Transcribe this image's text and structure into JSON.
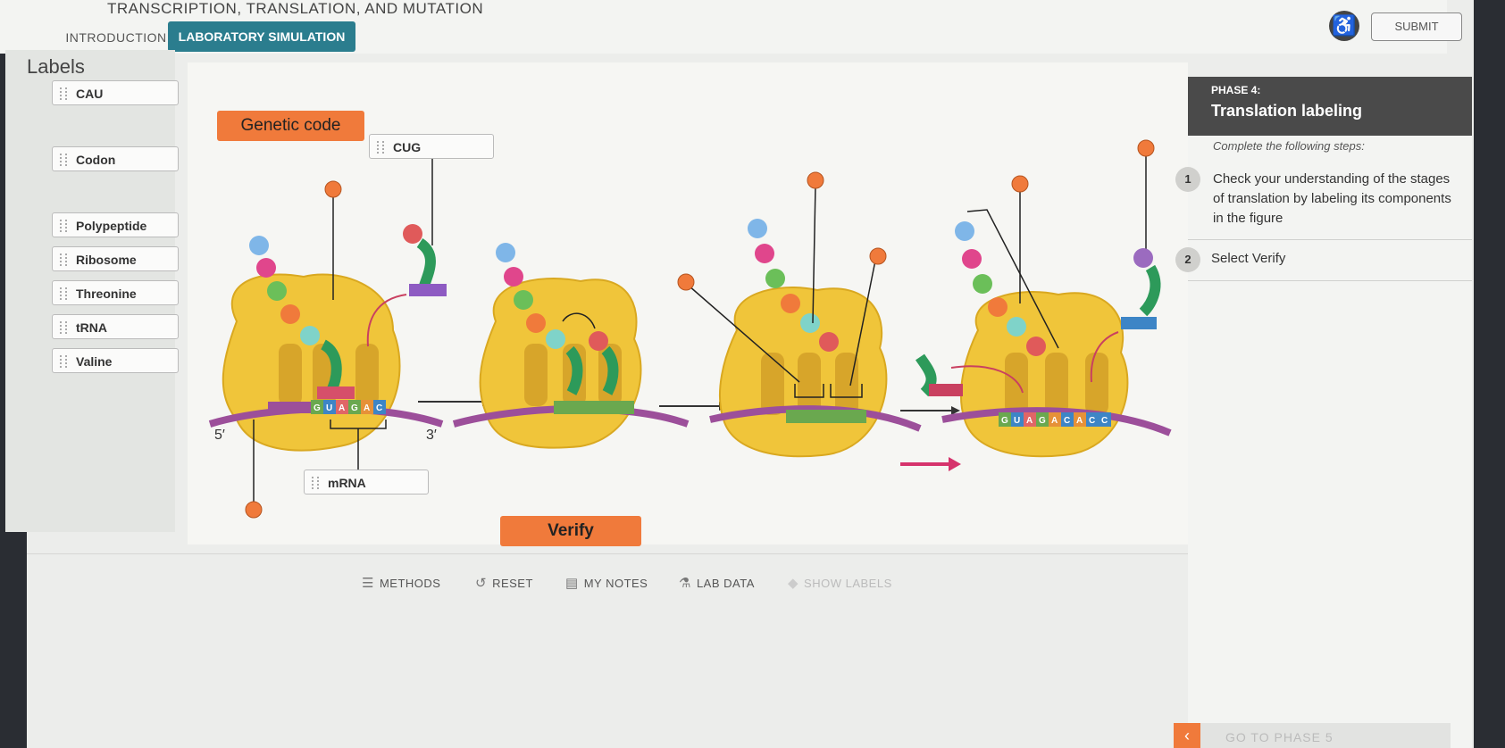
{
  "header": {
    "title_fragment": "TRANSCRIPTION, TRANSLATION, AND MUTATION",
    "tabs": [
      "INTRODUCTION",
      "LABORATORY SIMULATION"
    ],
    "submit_label": "SUBMIT",
    "accessibility_icon": "accessibility-icon"
  },
  "labels_panel": {
    "title": "Labels",
    "chips": [
      "CAU",
      "Codon",
      "Polypeptide",
      "Ribosome",
      "Threonine",
      "tRNA",
      "Valine"
    ]
  },
  "figure": {
    "genetic_code_label": "Genetic code",
    "placed_labels": [
      "CUG",
      "mRNA"
    ],
    "five_prime": "5′",
    "three_prime": "3′",
    "verify_label": "Verify",
    "codons": {
      "panel1": [
        "G",
        "U",
        "A",
        "G",
        "A",
        "C"
      ],
      "panel4": [
        "G",
        "U",
        "A",
        "G",
        "A",
        "C",
        "A",
        "C",
        "C"
      ]
    }
  },
  "toolbar": {
    "items": [
      {
        "label": "METHODS",
        "icon": "methods-icon"
      },
      {
        "label": "RESET",
        "icon": "reset-icon"
      },
      {
        "label": "MY NOTES",
        "icon": "notes-icon"
      },
      {
        "label": "LAB DATA",
        "icon": "flask-icon"
      },
      {
        "label": "SHOW LABELS",
        "icon": "tag-icon"
      }
    ]
  },
  "phase": {
    "number": "PHASE 4:",
    "title": "Translation labeling",
    "intro": "Complete the following steps:",
    "steps": [
      {
        "num": "1",
        "text": "Check your understanding of the stages of translation by labeling its components in the figure"
      },
      {
        "num": "2",
        "text": "Select Verify"
      }
    ],
    "next_label": "GO TO PHASE 5"
  },
  "colors": {
    "accent_teal": "#2b7d8e",
    "accent_orange": "#f07a3b",
    "ribosome": "#f0c53a",
    "mrna": "#9c4f9a"
  }
}
